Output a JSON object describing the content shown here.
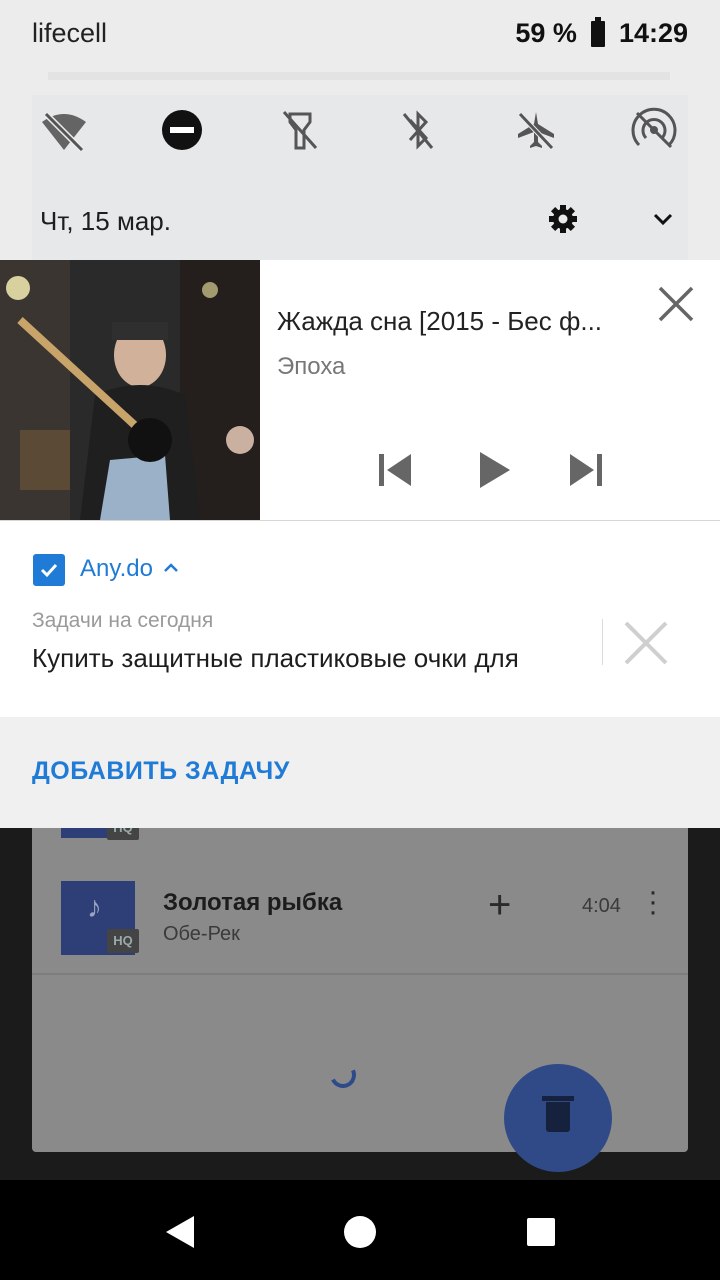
{
  "status_bar": {
    "carrier": "lifecell",
    "battery": "59 %",
    "time": "14:29"
  },
  "quick_settings": {
    "icons": [
      "wifi-off-icon",
      "do-not-disturb-icon",
      "flashlight-off-icon",
      "bluetooth-off-icon",
      "airplane-mode-off-icon",
      "hotspot-off-icon"
    ],
    "date": "Чт, 15 мар."
  },
  "media_notification": {
    "title": "Жажда сна [2015 - Бес ф...",
    "artist": "Эпоха"
  },
  "anydo_notification": {
    "app_name": "Any.do",
    "subtitle": "Задачи на сегодня",
    "task": "Купить защитные пластиковые очки для",
    "action": "ДОБАВИТЬ ЗАДАЧУ",
    "accent": "#1f7bd6"
  },
  "background_app": {
    "track_title": "Золотая рыбка",
    "track_artist": "Обе-Рек",
    "duration": "4:04",
    "hq_badge": "HQ"
  }
}
